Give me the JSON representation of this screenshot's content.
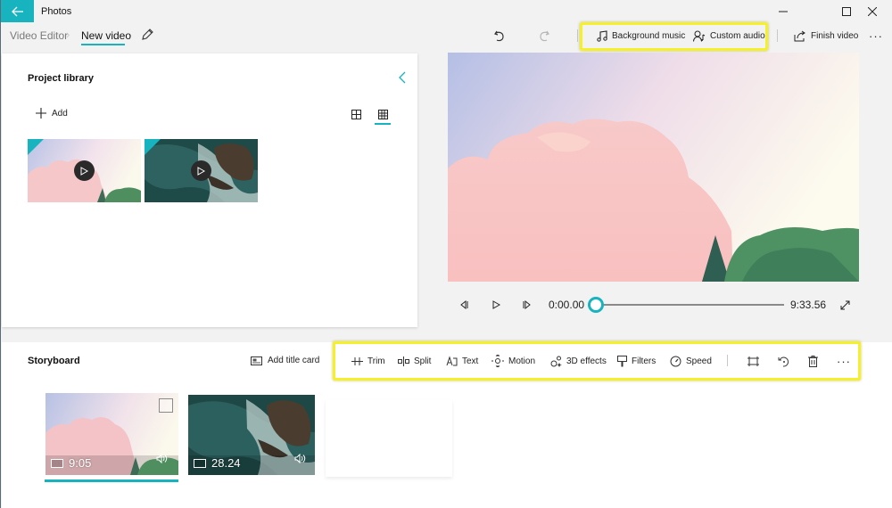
{
  "app": {
    "title": "Photos",
    "accent": "#17b3bf",
    "highlight": "#f6f02a"
  },
  "window_controls": {
    "minimize": "minimize-icon",
    "maximize": "maximize-icon",
    "close": "close-icon"
  },
  "breadcrumb": {
    "parent": "Video Editor",
    "separator": "›",
    "current": "New video"
  },
  "toolbar": {
    "undo_icon": "undo-icon",
    "redo_icon": "redo-icon",
    "background_music": "Background music",
    "custom_audio": "Custom audio",
    "finish_video": "Finish video",
    "more": "···"
  },
  "library": {
    "title": "Project library",
    "add_label": "Add",
    "views": [
      "large-grid-icon",
      "small-grid-icon"
    ],
    "selected_view": "small-grid-icon",
    "items": [
      {
        "name": "clouds-clip",
        "in_use": true
      },
      {
        "name": "ocean-rocks-clip",
        "in_use": true
      }
    ]
  },
  "player": {
    "current_time": "0:00.00",
    "total_time": "9:33.56",
    "progress": 0
  },
  "storyboard": {
    "title": "Storyboard",
    "add_title_card": "Add title card",
    "tools": [
      "Trim",
      "Split",
      "Text",
      "Motion",
      "3D effects",
      "Filters",
      "Speed"
    ],
    "icon_tools": [
      "resize-icon",
      "rotate-icon",
      "delete-icon",
      "more-icon"
    ],
    "more": "···",
    "clips": [
      {
        "duration": "9:05",
        "selected": true
      },
      {
        "duration": "28.24",
        "selected": false
      }
    ]
  }
}
